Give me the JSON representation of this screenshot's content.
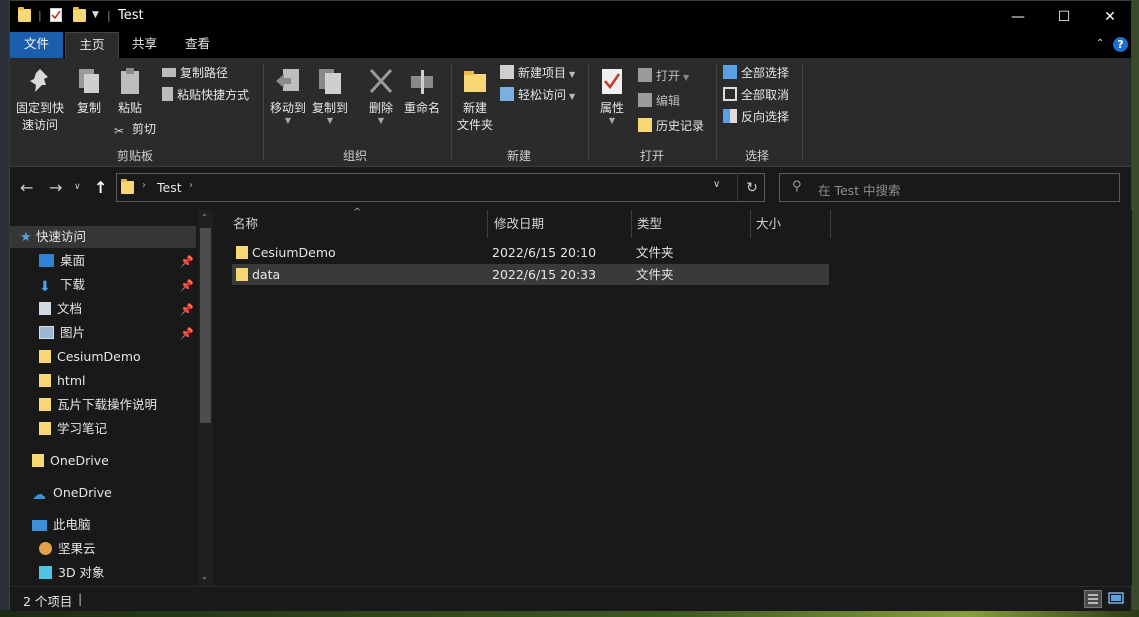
{
  "window": {
    "title": "Test",
    "qat_separator": "|",
    "minimize_glyph": "—",
    "maximize_glyph": "☐",
    "close_glyph": "✕"
  },
  "ribbon_tabs": [
    {
      "label": "文件"
    },
    {
      "label": "主页"
    },
    {
      "label": "共享"
    },
    {
      "label": "查看"
    }
  ],
  "ribbon": {
    "clipboard": {
      "pin_label_1": "固定到快",
      "pin_label_2": "速访问",
      "copy_label": "复制",
      "paste_label": "粘贴",
      "copy_path_label": "复制路径",
      "paste_shortcut_label": "粘贴快捷方式",
      "cut_label": "剪切",
      "group_label": "剪贴板"
    },
    "organize": {
      "move_to_label": "移动到",
      "copy_to_label": "复制到",
      "delete_label": "删除",
      "rename_label": "重命名",
      "group_label": "组织"
    },
    "new": {
      "new_folder_label_1": "新建",
      "new_folder_label_2": "文件夹",
      "new_item_label": "新建项目",
      "easy_access_label": "轻松访问",
      "group_label": "新建"
    },
    "open": {
      "properties_label": "属性",
      "open_label": "打开",
      "edit_label": "编辑",
      "history_label": "历史记录",
      "group_label": "打开"
    },
    "select": {
      "select_all_label": "全部选择",
      "select_none_label": "全部取消",
      "invert_label": "反向选择",
      "group_label": "选择"
    }
  },
  "address": {
    "segment": "Test",
    "search_placeholder": "在 Test 中搜索"
  },
  "nav_pane": {
    "quick_access": "快速访问",
    "items": [
      {
        "label": "桌面",
        "pinned": true
      },
      {
        "label": "下载",
        "pinned": true
      },
      {
        "label": "文档",
        "pinned": true
      },
      {
        "label": "图片",
        "pinned": true
      },
      {
        "label": "CesiumDemo",
        "pinned": false
      },
      {
        "label": "html",
        "pinned": false
      },
      {
        "label": "瓦片下载操作说明",
        "pinned": false
      },
      {
        "label": "学习笔记",
        "pinned": false
      }
    ],
    "onedrive_personal": "OneDrive",
    "onedrive": "OneDrive",
    "this_pc": "此电脑",
    "jianguoyun": "坚果云",
    "objects_3d": "3D 对象"
  },
  "columns": {
    "name": "名称",
    "modified": "修改日期",
    "type": "类型",
    "size": "大小"
  },
  "files": [
    {
      "name": "CesiumDemo",
      "modified": "2022/6/15 20:10",
      "type": "文件夹",
      "size": "",
      "selected": false
    },
    {
      "name": "data",
      "modified": "2022/6/15 20:33",
      "type": "文件夹",
      "size": "",
      "selected": true
    }
  ],
  "status": {
    "item_count": "2 个项目"
  },
  "colors": {
    "accent": "#1c5eab",
    "folder": "#f8d775",
    "background": "#191919",
    "ribbon": "#2b2b2b"
  }
}
